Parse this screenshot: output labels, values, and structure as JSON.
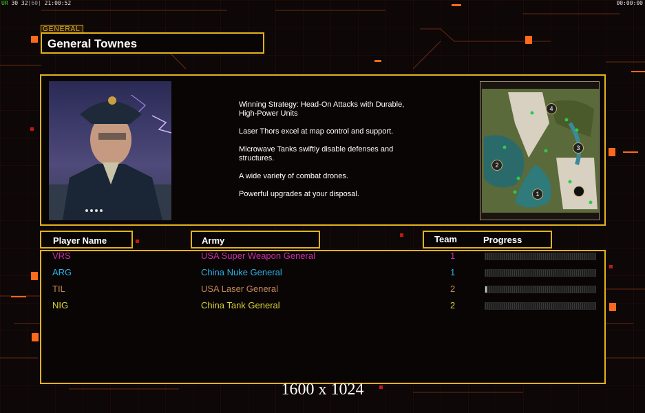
{
  "hud": {
    "left_prefix": "UR",
    "left_values": "30 32",
    "left_bracket": "[60]",
    "left_time": "21:00:52",
    "right_time": "00:00:00"
  },
  "general": {
    "tag": "GENERAL",
    "name": "General Townes"
  },
  "strategy": [
    "Winning Strategy: Head-On Attacks with Durable,\n High-Power Units",
    "Laser Thors excel at map control and support.",
    "Microwave Tanks swiftly disable defenses and\n structures.",
    "A wide variety of combat drones.",
    "Powerful upgrades at your disposal."
  ],
  "map": {
    "start_positions": [
      "1",
      "2",
      "3",
      "4"
    ]
  },
  "table": {
    "headers": {
      "player": "Player Name",
      "army": "Army",
      "team": "Team",
      "progress": "Progress"
    },
    "rows": [
      {
        "player": "VRS",
        "army": "USA Super Weapon General",
        "team": "1",
        "color": "#cc2ea8",
        "progress": 0.0
      },
      {
        "player": "ARG",
        "army": "China Nuke General",
        "team": "1",
        "color": "#27b3e6",
        "progress": 0.0
      },
      {
        "player": "TIL",
        "army": "USA Laser General",
        "team": "2",
        "color": "#c4875a",
        "progress": 0.01
      },
      {
        "player": "NIG",
        "army": "China Tank General",
        "team": "2",
        "color": "#d9d33a",
        "progress": 0.0
      }
    ]
  },
  "resolution": "1600 x 1024",
  "colors": {
    "accent": "#e2b21e",
    "glow": "#ff6a1a"
  }
}
